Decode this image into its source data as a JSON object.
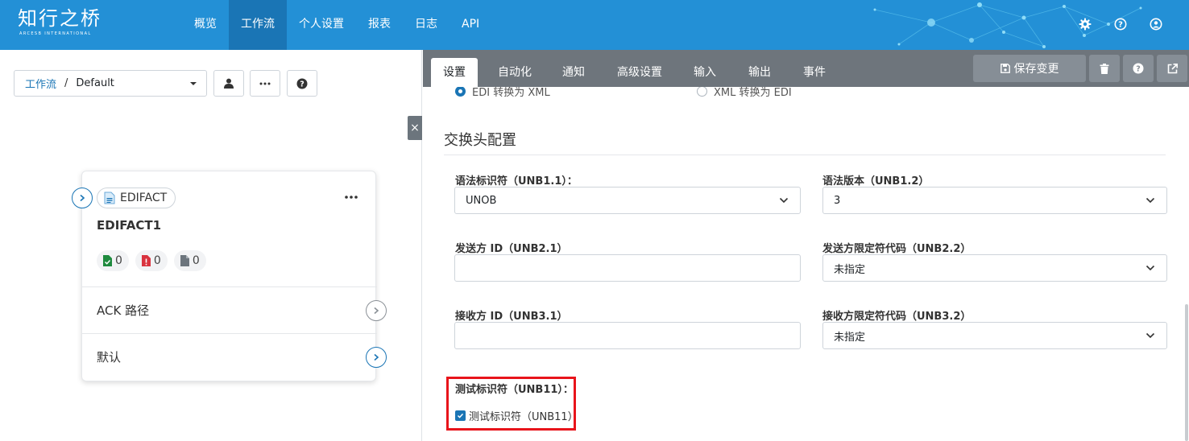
{
  "brand": {
    "logo_text": "知行之桥",
    "logo_subtext": "ARCESB INTERNATIONAL"
  },
  "topnav": {
    "items": [
      {
        "label": "概览",
        "active": false
      },
      {
        "label": "工作流",
        "active": true
      },
      {
        "label": "个人设置",
        "active": false
      },
      {
        "label": "报表",
        "active": false
      },
      {
        "label": "日志",
        "active": false
      },
      {
        "label": "API",
        "active": false
      }
    ],
    "icons": [
      "gear-icon",
      "help-circle-icon",
      "user-circle-icon"
    ],
    "color": "#2390d6",
    "active_color": "#1a75b5"
  },
  "breadcrumb": {
    "link": "工作流",
    "separator": "/",
    "current": "Default"
  },
  "left_toolbar": {
    "icons": [
      "user-icon",
      "more-icon",
      "help-icon"
    ],
    "close_label": "×"
  },
  "card": {
    "connector_type": "EDIFACT",
    "name": "EDIFACT1",
    "menu_icon": "ellipsis-icon",
    "counters": [
      {
        "icon": "file-check-icon",
        "value": "0",
        "color": "#1e8a3e"
      },
      {
        "icon": "file-error-icon",
        "value": "0",
        "color": "#d9333f"
      },
      {
        "icon": "file-icon",
        "value": "0",
        "color": "#6c757d"
      }
    ],
    "rows": [
      {
        "label": "ACK 路径"
      },
      {
        "label": "默认"
      }
    ]
  },
  "tabs": {
    "items": [
      "设置",
      "自动化",
      "通知",
      "高级设置",
      "输入",
      "输出",
      "事件"
    ],
    "active_index": 0
  },
  "actions": {
    "save_label": "保存变更",
    "icons": [
      "trash-icon",
      "help-icon",
      "external-link-icon"
    ]
  },
  "translation_mode": {
    "options": [
      {
        "label": "EDI 转换为 XML",
        "checked": true
      },
      {
        "label": "XML 转换为 EDI",
        "checked": false
      }
    ]
  },
  "section": {
    "title": "交换头配置"
  },
  "fields": {
    "syntax_id": {
      "label": "语法标识符（UNB1.1）：",
      "value": "UNOB",
      "type": "select"
    },
    "syntax_version": {
      "label": "语法版本（UNB1.2）",
      "value": "3",
      "type": "select"
    },
    "sender_id": {
      "label": "发送方 ID（UNB2.1）",
      "value": "",
      "type": "text"
    },
    "sender_qualifier": {
      "label": "发送方限定符代码（UNB2.2）",
      "value": "未指定",
      "type": "select"
    },
    "receiver_id": {
      "label": "接收方 ID（UNB3.1）",
      "value": "",
      "type": "text"
    },
    "receiver_qualifier": {
      "label": "接收方限定符代码（UNB3.2）",
      "value": "未指定",
      "type": "select"
    },
    "test_indicator": {
      "label": "测试标识符（UNB11）：",
      "checkbox_label": "测试标识符（UNB11）",
      "checked": true
    }
  },
  "colors": {
    "accent": "#1a75b5",
    "tabbar": "#6e757c",
    "highlight": "#e8141b"
  }
}
